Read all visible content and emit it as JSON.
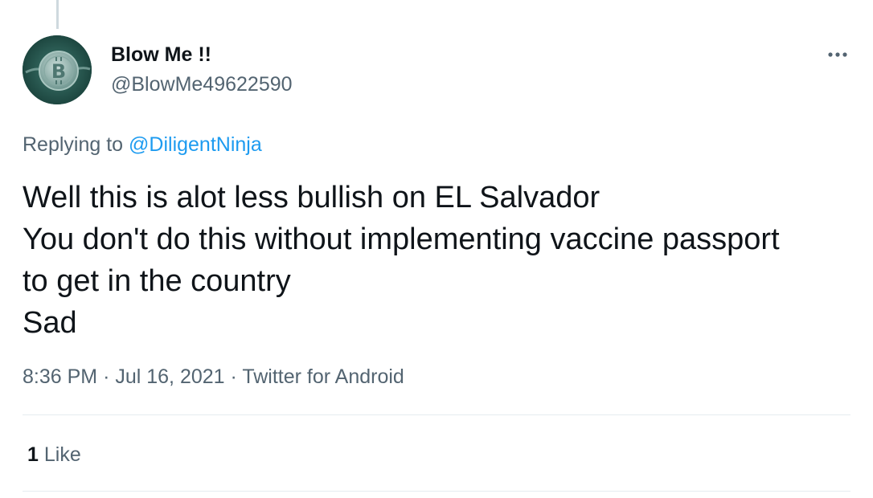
{
  "author": {
    "display_name": "Blow Me !!",
    "handle": "@BlowMe49622590",
    "avatar_icon": "bitcoin-coin-avatar"
  },
  "more_icon": "more-horizontal-icon",
  "reply": {
    "prefix": "Replying to",
    "mention": "@DiligentNinja"
  },
  "tweet": {
    "lines": [
      "Well this is alot less bullish on EL Salvador",
      "You don't do this without implementing vaccine passport",
      "to get in the country",
      "Sad"
    ]
  },
  "meta": {
    "time": "8:36 PM",
    "separator": "·",
    "date": "Jul 16, 2021",
    "source": "Twitter for Android"
  },
  "stats": {
    "like_count": "1",
    "like_label": "Like"
  },
  "colors": {
    "text_primary": "#0f1419",
    "text_secondary": "#536471",
    "link": "#1d9bf0",
    "divider": "#e6ecf0"
  }
}
